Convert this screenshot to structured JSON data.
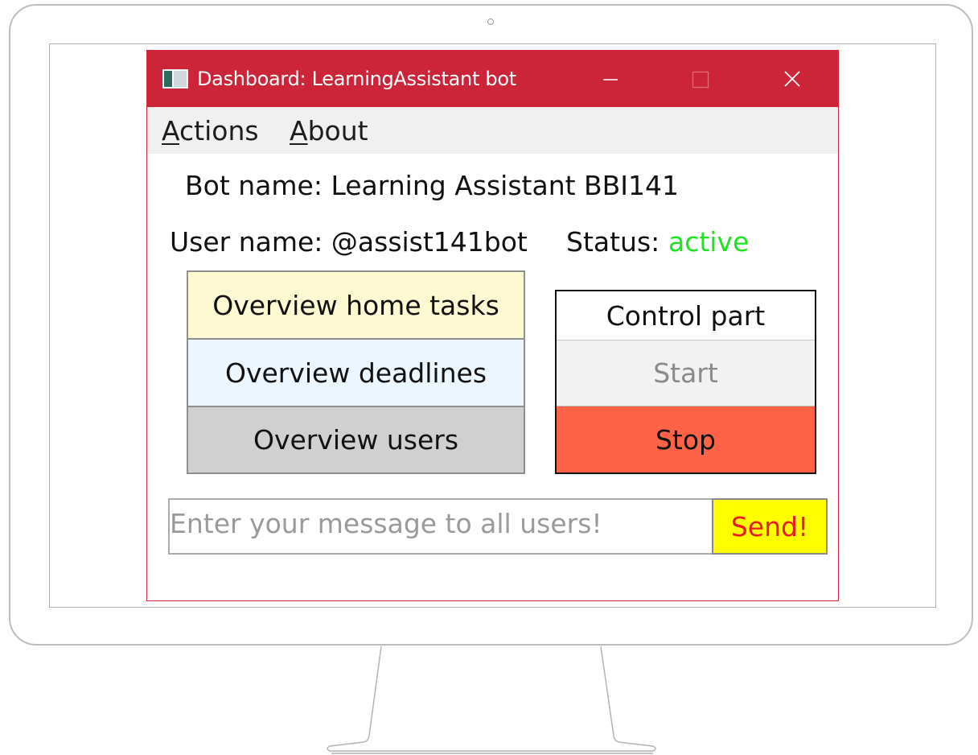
{
  "window": {
    "title": "Dashboard: LearningAssistant bot",
    "accent_color": "#cc2539",
    "controls": {
      "minimize_icon": "minimize-icon",
      "maximize_icon": "maximize-icon",
      "close_icon": "close-icon"
    }
  },
  "menu": {
    "actions": {
      "mnemonic": "A",
      "rest": "ctions"
    },
    "about": {
      "mnemonic": "A",
      "rest": "bout"
    }
  },
  "info": {
    "bot_name": "Bot name: Learning Assistant BBI141",
    "user_name": "User name: @assist141bot",
    "status_label": "Status:",
    "status_value": "active",
    "status_color": "#22e022"
  },
  "overview_buttons": {
    "home_tasks": "Overview home tasks",
    "deadlines": "Overview deadlines",
    "users": "Overview users"
  },
  "control": {
    "title": "Control part",
    "start": "Start",
    "stop": "Stop",
    "stop_color": "#ff6347"
  },
  "message": {
    "placeholder": "Enter your message to all users!",
    "value": "",
    "send": "Send!",
    "send_bg": "#ffff00",
    "send_text_color": "#e81c1c"
  }
}
